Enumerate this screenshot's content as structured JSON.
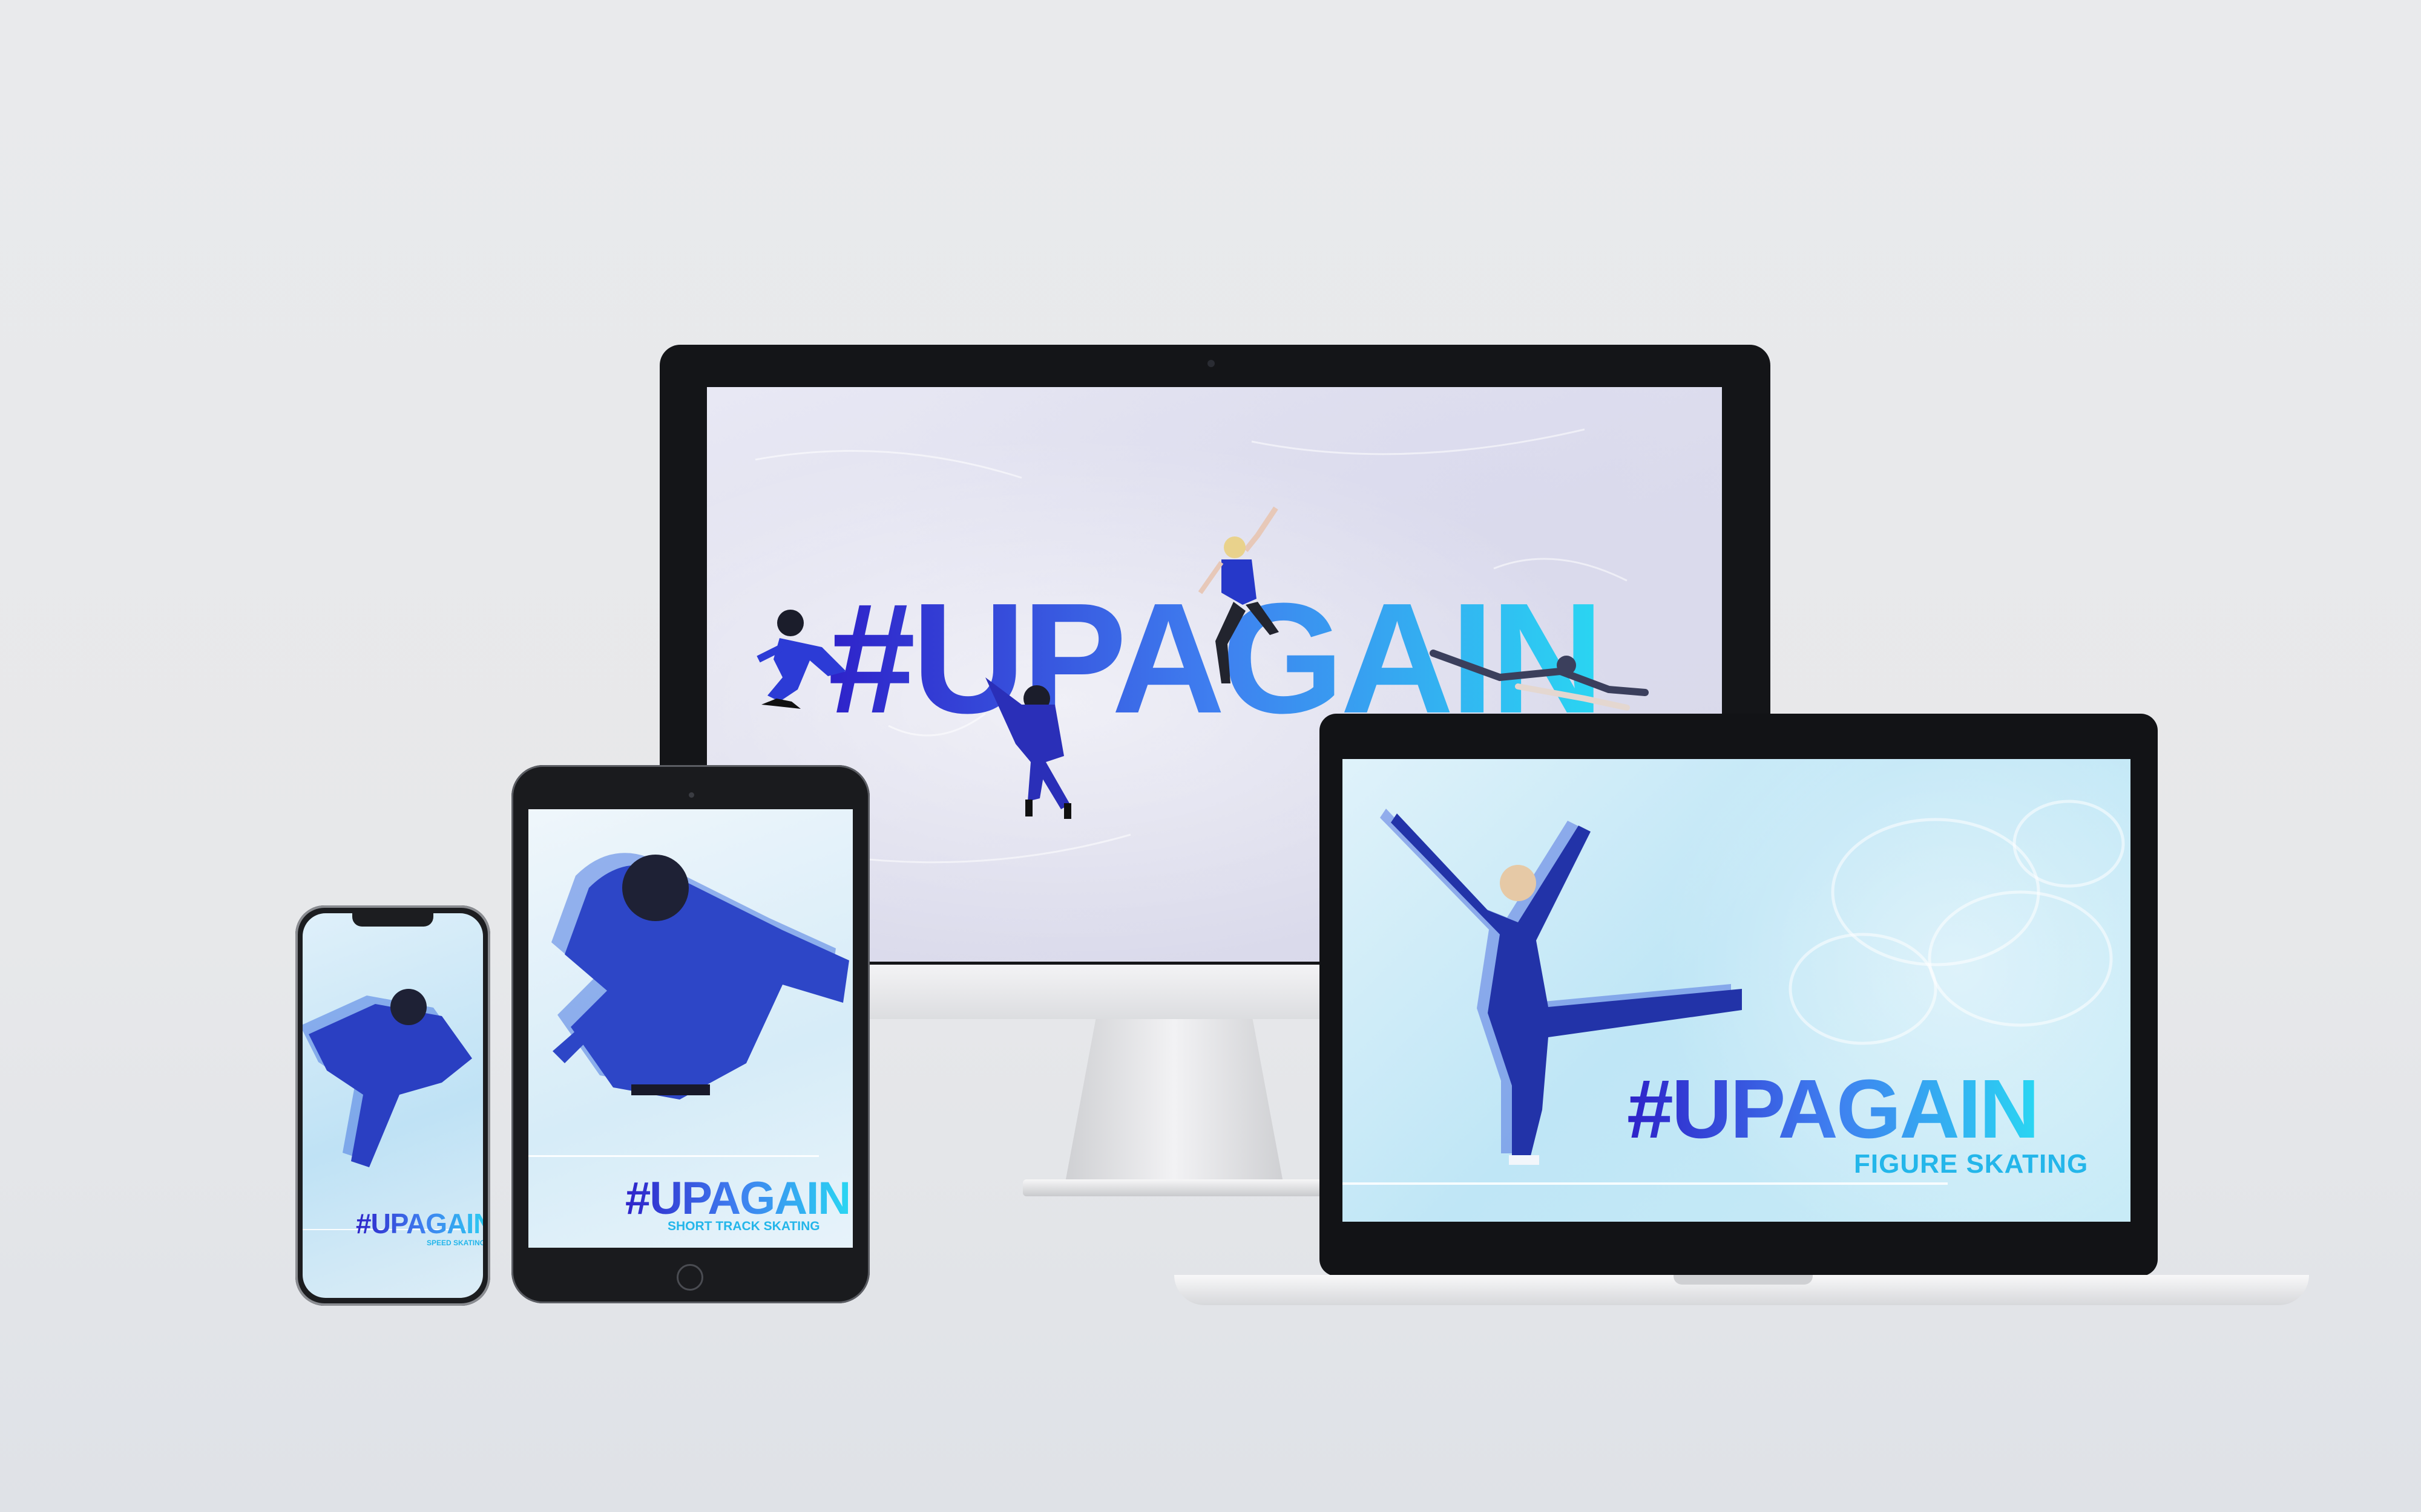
{
  "scene": {
    "background_color": "#e8e9eb",
    "gradient_colors": {
      "start": "#2e22c9",
      "mid": "#3f7ff0",
      "end": "#2ad6f2"
    },
    "accent_subtitle_color": "#24b6ea"
  },
  "desktop": {
    "device": "desktop-monitor",
    "headline": "#UPAGAIN"
  },
  "laptop": {
    "device": "laptop",
    "headline": "#UPAGAIN",
    "subtitle": "FIGURE SKATING"
  },
  "tablet": {
    "device": "tablet",
    "headline": "#UPAGAIN",
    "subtitle": "SHORT TRACK SKATING"
  },
  "phone": {
    "device": "smartphone",
    "headline": "#UPAGAIN",
    "subtitle": "SPEED SKATING"
  }
}
